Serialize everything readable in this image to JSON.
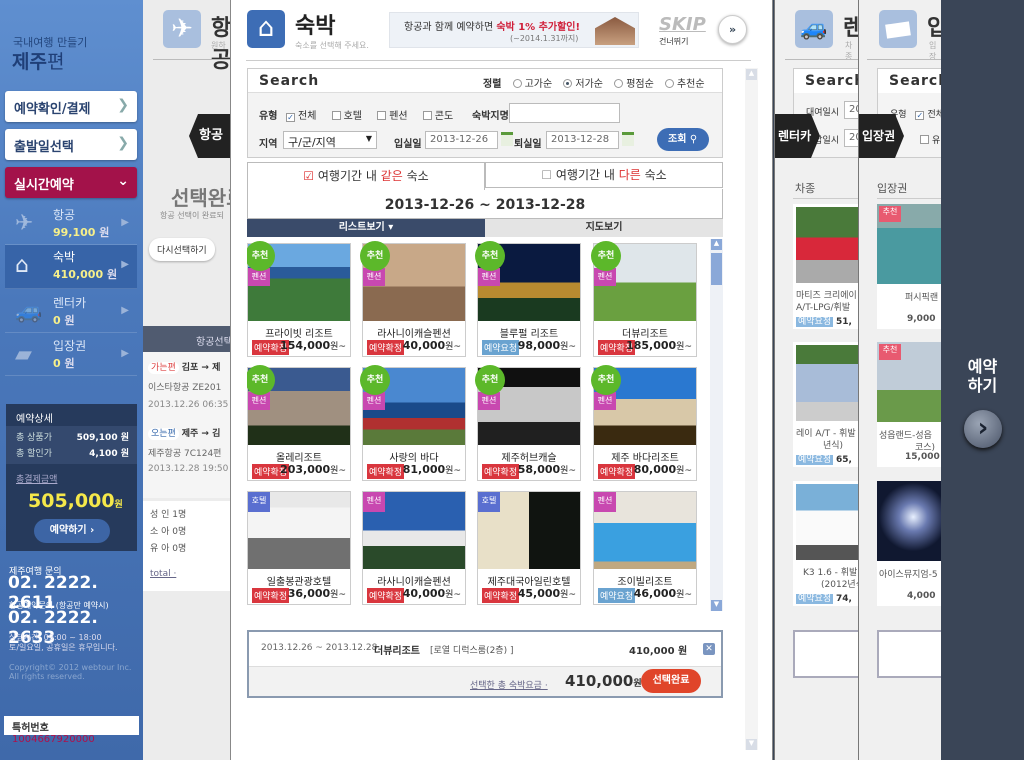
{
  "sidebar": {
    "subtitle": "국내여행 만들기",
    "title_a": "제주",
    "title_b": "편",
    "btn_confirm": "예약확인/결제",
    "btn_date": "출발일선택",
    "btn_realtime": "실시간예약",
    "items": [
      {
        "label": "항공",
        "price": "99,100",
        "unit": "원"
      },
      {
        "label": "숙박",
        "price": "410,000",
        "unit": "원"
      },
      {
        "label": "렌터카",
        "price": "0",
        "unit": "원"
      },
      {
        "label": "입장권",
        "price": "0",
        "unit": "원"
      }
    ],
    "detail": {
      "title": "예약상세",
      "total_label": "총 상품가",
      "total": "509,100 원",
      "discount_label": "총 할인가",
      "discount": "4,100 원",
      "final_label": "총결제금액",
      "final": "505,000",
      "final_unit": "원",
      "book": "예약하기 ›"
    },
    "contact1_label": "제주여행 문의",
    "contact1": "02. 2222. 2611",
    "contact2_label": "항공예약문의 (항공만 예약시)",
    "contact2": "02. 2222. 2633",
    "hours": "상담시간: 09:00 ~ 18:00",
    "holiday": "토/일요일, 공휴일은 휴무입니다.",
    "copyright": "Copyright© 2012 webtour Inc.",
    "rights": "All rights reserved.",
    "patent_label": "특허번호",
    "patent": "1004667920000"
  },
  "flight": {
    "title": "항공",
    "subtitle": "원하",
    "tag": "항공",
    "done": "선택완료",
    "done_sub": "항공 선택이 완료되",
    "reselect": "다시선택하기",
    "bar": "항공선택",
    "go_badge": "가는편",
    "go_route": "김포 → 제",
    "go_air": "이스타항공 ZE201",
    "go_time": "2013.12.26 06:35 ~",
    "back_badge": "오는편",
    "back_route": "제주 → 김",
    "back_air": "제주항공 7C124편",
    "back_time": "2013.12.28 19:50 ~",
    "adult": "성 인 1명",
    "child": "소 아 0명",
    "infant": "유 아 0명",
    "total": "total ·"
  },
  "main": {
    "title": "숙박",
    "subtitle": "숙소를 선택해 주세요.",
    "banner_a": "항공과 함께 예약하면 ",
    "banner_b": "숙박 1% 추가할인!",
    "banner_c": "(~2014.1.31까지)",
    "skip": "SKIP",
    "skip_sub": "건너뛰기",
    "skip_icon": "»",
    "search": {
      "title": "Search",
      "sort_label": "정렬",
      "sorts": [
        "고가순",
        "저가순",
        "평점순",
        "추천순"
      ],
      "sort_selected": "저가순",
      "type_label": "유형",
      "types": [
        "전체",
        "호텔",
        "펜션",
        "콘도"
      ],
      "name_label": "숙박지명",
      "name_value": "",
      "region_label": "지역",
      "region_value": "구/군/지역",
      "checkin_label": "입실일",
      "checkin": "2013-12-26",
      "checkout_label": "퇴실일",
      "checkout": "2013-12-28",
      "go": "조회"
    },
    "tab_same_a": "여행기간 내 ",
    "tab_same_b": "같은",
    "tab_same_c": " 숙소",
    "tab_diff_a": "여행기간 내 ",
    "tab_diff_b": "다른",
    "tab_diff_c": " 숙소",
    "period": "2013-12-26 ~ 2013-12-28",
    "view_list": "리스트보기 ▾",
    "view_map": "지도보기",
    "cards": [
      {
        "name": "프라이빗 리조트",
        "status": "예약확정",
        "price": "154,000",
        "unit": "원~",
        "rec": "추천",
        "type": "펜션",
        "img": "linear-gradient(180deg,#6aa8e0 0 30%,#2a5b9a 30% 45%,#3e7a3a 45% 100%)"
      },
      {
        "name": "라사니이캐슬펜션",
        "status": "예약확정",
        "price": "40,000",
        "unit": "원~",
        "rec": "추천",
        "type": "펜션",
        "img": "linear-gradient(180deg,#c8a888 0 55%,#8a6a50 55% 100%)"
      },
      {
        "name": "블루펄 리조트",
        "status": "예약요청",
        "price": "98,000",
        "unit": "원~",
        "rec": "추천",
        "type": "펜션",
        "img": "linear-gradient(180deg,#0a1a40 0 50%,#b88a30 50% 70%,#1a3a20 70%)"
      },
      {
        "name": "더뷰리조트",
        "status": "예약확정",
        "price": "185,000",
        "unit": "원~",
        "rec": "추천",
        "type": "펜션",
        "img": "linear-gradient(180deg,#dfe6ea 0 50%,#6aa040 50% 100%)"
      },
      {
        "name": "올레리조트",
        "status": "예약확정",
        "price": "203,000",
        "unit": "원~",
        "rec": "추천",
        "type": "펜션",
        "img": "linear-gradient(180deg,#3a5a90 0 30%,#a09080 30% 75%,#203018 75%)"
      },
      {
        "name": "사랑의 바다",
        "status": "예약확정",
        "price": "81,000",
        "unit": "원~",
        "rec": "추천",
        "type": "펜션",
        "img": "linear-gradient(180deg,#4a88d0 0 45%,#1a4a8a 45% 65%,#b03030 65% 80%,#5a7a3a 80%)"
      },
      {
        "name": "제주허브캐슬",
        "status": "예약확정",
        "price": "58,000",
        "unit": "원~",
        "rec": "추천",
        "type": "펜션",
        "img": "linear-gradient(180deg,#101010 0 25%,#c8c8c8 25% 70%,#202020 70%)"
      },
      {
        "name": "제주 바다리조트",
        "status": "예약확정",
        "price": "80,000",
        "unit": "원~",
        "rec": "추천",
        "type": "펜션",
        "img": "linear-gradient(180deg,#2a78d0 0 40%,#d8c8a8 40% 75%,#3a2a10 75%)"
      },
      {
        "name": "일출봉관광호텔",
        "status": "예약확정",
        "price": "36,000",
        "unit": "원~",
        "rec": "",
        "type": "호텔",
        "img": "linear-gradient(180deg,#e8e8e8 0 20%,#f4f4f4 20% 60%,#707070 60%)"
      },
      {
        "name": "라사니이캐슬펜션",
        "status": "예약확정",
        "price": "40,000",
        "unit": "원~",
        "rec": "",
        "type": "펜션",
        "img": "linear-gradient(180deg,#2a60b0 0 50%,#e8e8e8 50% 70%,#2a4a2a 70%)"
      },
      {
        "name": "제주대국아일린호텔",
        "status": "예약확정",
        "price": "45,000",
        "unit": "원~",
        "rec": "",
        "type": "호텔",
        "img": "linear-gradient(90deg,#e8e0c8 0 50%,#101410 50%)"
      },
      {
        "name": "조이빌리조트",
        "status": "예약요청",
        "price": "46,000",
        "unit": "원~",
        "rec": "",
        "type": "펜션",
        "img": "linear-gradient(180deg,#e8e4dc 0 40%,#3aa0e0 40% 90%,#c0a880 90%)"
      }
    ],
    "summary": {
      "dates": "2013.12.26 ~ 2013.12.28",
      "hotel": "더뷰리조트",
      "room": "[로열 디럭스룸(2층) ]",
      "price": "410,000 원",
      "total_label": "선택한 총 숙박요금 ·",
      "total": "410,000",
      "unit": "원",
      "done": "선택완료"
    }
  },
  "rentcar": {
    "title": "렌",
    "sub": "차종",
    "search": "Search",
    "row1": "대여일시",
    "row1v": "20",
    "row2": "반납일시",
    "row2v": "20",
    "tag": "렌터카",
    "section": "차종",
    "cars": [
      {
        "name": "마티즈 크리에이",
        "name2": "A/T-LPG/휘발",
        "status": "예약요청",
        "price": "51,"
      },
      {
        "name": "레이 A/T - 휘발",
        "name2": "년식)",
        "status": "예약요청",
        "price": "65,"
      },
      {
        "name": "K3 1.6 - 휘발",
        "name2": "(2012년식",
        "status": "예약요청",
        "price": "74,"
      }
    ]
  },
  "ticket": {
    "title": "입",
    "sub": "입장",
    "search": "Search",
    "row1": "유형",
    "row1v": "전체",
    "row2v": "유",
    "tag": "입장권",
    "section": "입장권",
    "items": [
      {
        "name": "퍼시픽랜",
        "price": "9,000",
        "rec": "추천"
      },
      {
        "name": "성읍랜드-성읍",
        "name2": "코스)",
        "price": "15,000",
        "rec": "추천"
      },
      {
        "name": "아이스뮤지엄-5",
        "price": "4,000",
        "rec": ""
      }
    ]
  },
  "book_panel": {
    "label_a": "예약",
    "label_b": "하기",
    "icon": "›"
  },
  "colors": {
    "confirmed": "#d9363e",
    "request": "#6aa3d0",
    "accent": "#a3124a",
    "sidebar": "#4a78bb"
  }
}
